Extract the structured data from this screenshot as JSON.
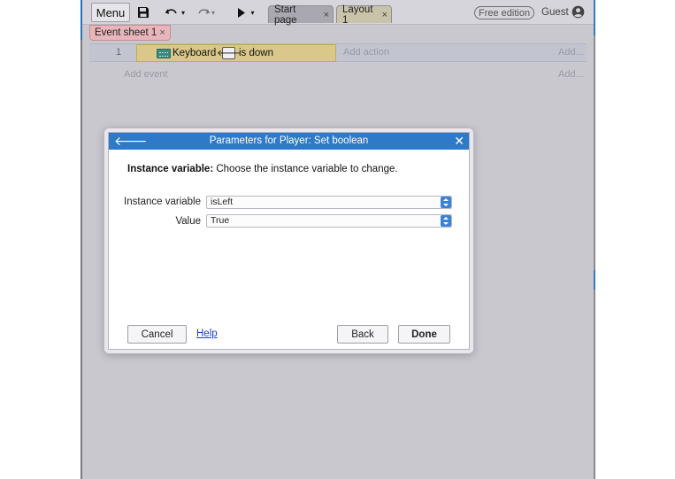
{
  "toolbar": {
    "menu_label": "Menu",
    "save_icon": "floppy-disk-icon",
    "undo_icon": "undo-icon",
    "redo_icon": "redo-icon",
    "play_icon": "play-icon",
    "dropdown_glyph": "▾"
  },
  "tabs": [
    {
      "label": "Start page",
      "close": "×"
    },
    {
      "label": "Layout 1",
      "close": "×"
    }
  ],
  "edition_badge": "Free edition",
  "user": {
    "name": "Guest",
    "icon": "user-circle-icon"
  },
  "sheet_tab": {
    "label": "Event sheet 1",
    "close": "×"
  },
  "event": {
    "number": "1",
    "condition_object": "Keyboard",
    "condition_icon": "keyboard-icon",
    "key_icon": "left-arrow-key-icon",
    "key_glyph": "🡐",
    "condition_text": "is down",
    "add_action": "Add action",
    "add_more": "Add..."
  },
  "add_event": {
    "label": "Add event",
    "add_more": "Add..."
  },
  "dialog": {
    "title": "Parameters for Player: Set boolean",
    "back_glyph": "🡐",
    "close_glyph": "✕",
    "instruction_bold": "Instance variable:",
    "instruction_text": " Choose the instance variable to change.",
    "fields": [
      {
        "label": "Instance variable",
        "value": "isLeft"
      },
      {
        "label": "Value",
        "value": "True"
      }
    ],
    "buttons": {
      "cancel": "Cancel",
      "help": "Help",
      "back": "Back",
      "done": "Done"
    }
  },
  "colors": {
    "dialog_header": "#2f79c9",
    "condition_bg": "#d9c88a",
    "sheet_tab_bg": "#e8b5bb",
    "link": "#1a3fd6"
  }
}
